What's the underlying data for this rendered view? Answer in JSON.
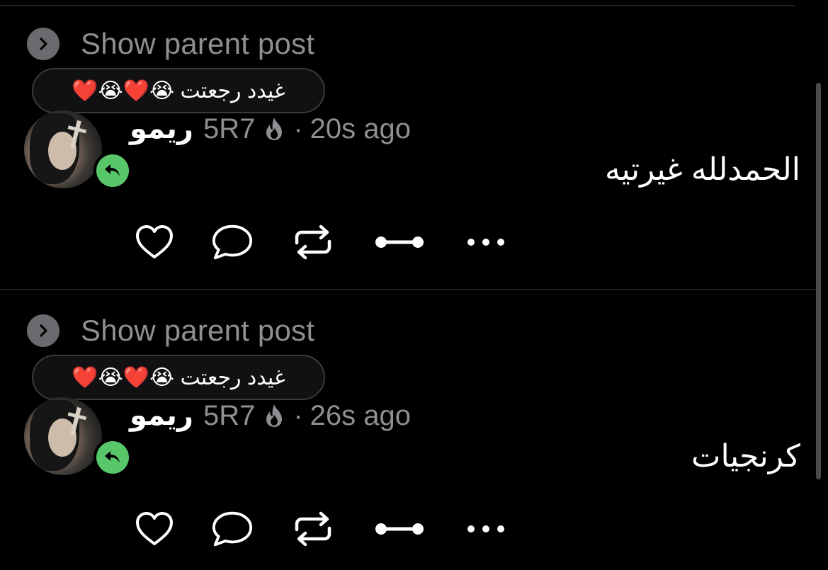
{
  "show_parent_label": "Show parent post",
  "posts": [
    {
      "status": "غيدد رجعتت 😭❤️😭❤️",
      "author": "ريمو",
      "handle": "5R7",
      "separator": "·",
      "time": "20s ago",
      "body": "الحمدلله غيرتيه"
    },
    {
      "status": "غيدد رجعتت 😭❤️😭❤️",
      "author": "ريمو",
      "handle": "5R7",
      "separator": "·",
      "time": "26s ago",
      "body": "كرنجيات"
    }
  ],
  "icons": {
    "show_parent": "chevron-right-icon",
    "reply_badge": "reply-arrow-icon",
    "streak": "flame-icon",
    "actions": [
      "heart-icon",
      "comment-icon",
      "repost-icon",
      "link-icon",
      "more-icon"
    ]
  },
  "colors": {
    "background": "#000000",
    "muted_text": "#8e8e93",
    "reply_badge": "#58c769"
  }
}
